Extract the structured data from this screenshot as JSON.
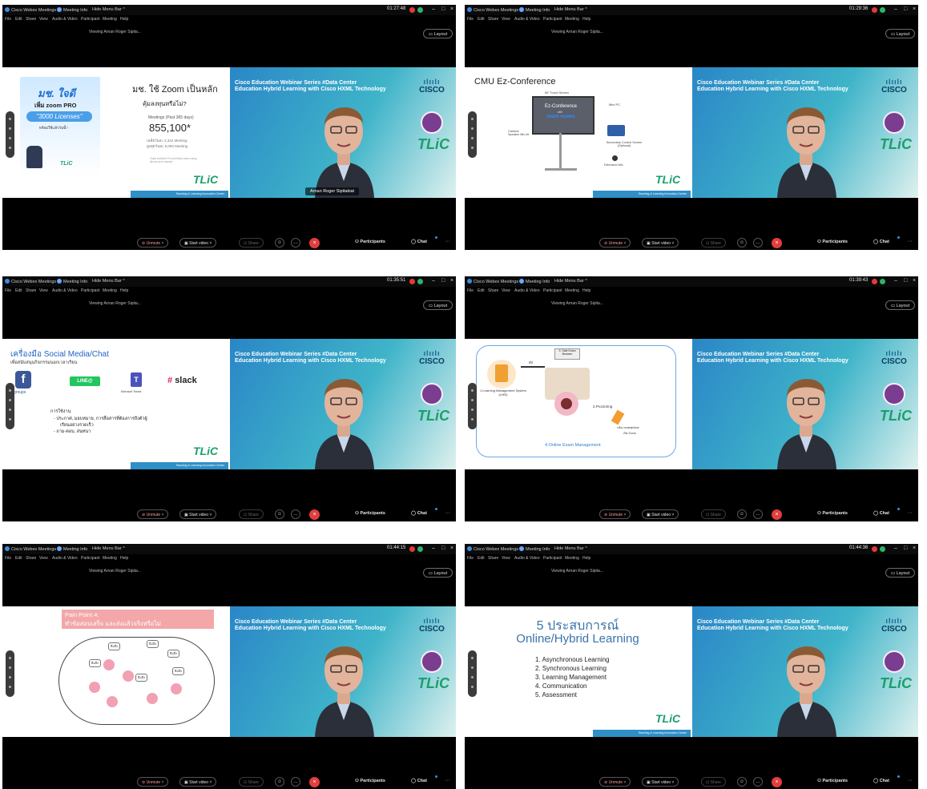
{
  "common": {
    "app_title": "Cisco Webex Meetings",
    "meeting_info": "Meeting Info",
    "hide_menu_bar": "Hide Menu Bar",
    "menu": [
      "File",
      "Edit",
      "Share",
      "View",
      "Audio & Video",
      "Participant",
      "Meeting",
      "Help"
    ],
    "viewing": "Viewing Arnan Roger Sipita...",
    "layout_label": "Layout",
    "unmute_label": "Unmute",
    "start_video_label": "Start video",
    "share_label": "Share",
    "participants_label": "Participants",
    "chat_label": "Chat",
    "video_title_line1": "Cisco Education Webinar Series #Data Center",
    "video_title_line2": "Education Hybrid Learning with Cisco HXML Technology",
    "cisco_brand": "CISCO",
    "tlic_brand": "TLiC",
    "slide_footer": "Teaching & Learning Innovation Center",
    "colors": {
      "end_button": "#e23e3e",
      "tlic_green": "#1aa06b",
      "recording_red": "#e03b3b"
    }
  },
  "screens": [
    {
      "time": "01:27:48",
      "name_tag": "Arnan Roger Sipitakiat",
      "slide": {
        "badge_line1": "มช. ใจดี",
        "badge_line2": "เพิ่ม zoom PRO",
        "badge_line3": "\"3000 Licenses\"",
        "badge_line4": "พร้อมใช้แล้ววันนี้ !",
        "title": "มช. ใช้ Zoom เป็นหลัก",
        "question": "คุ้มลงทุนหรือไม่?",
        "meetings_label": "Meetings (Past 365 days)",
        "meetings_value": "855,100*",
        "avg_line1": "เฉลี่ยวันละ 2,342 Meeting",
        "avg_line2": "สูงสุดวันละ 5,000 Meeting",
        "note": "*Data includes Pro and Basic users using @cmu.ac.th domain"
      }
    },
    {
      "time": "01:29:36",
      "slide": {
        "title": "CMU Ez-Conference",
        "label_touch": "65\" Touch Screen",
        "label_ez": "Ez-Conference",
        "label_with": "with",
        "label_zoom": "zoom rooms",
        "label_minipc": "Mini PC",
        "label_camera": "Camera Speaker Mic kit",
        "label_secondary": "Secondary Control Screen (Optional)",
        "label_extension": "Extension Mic"
      }
    },
    {
      "time": "01:35:51",
      "slide": {
        "title": "เครื่องมือ Social Media/Chat",
        "subtitle": "เพื่อสนับสนุนกิจกรรมนอกเวลาเรียน",
        "groups": "groups",
        "line": "LINE@",
        "teams": "Microsoft Teams",
        "slack": "slack",
        "usage": "การใช้งาน",
        "bullet1": "ประกาศ, มอบหมาย, การสื่อสารที่ต้องการถึงตัวผู้",
        "bullet1b": "เรียนอย่างรวดเร็ว",
        "bullet2": "ถาม-ตอบ, สนทนา"
      }
    },
    {
      "time": "01:39:43",
      "slide": {
        "step3": "3. Safe Exam Browser",
        "step1": "1.Learning Management System (LMS)",
        "step2": "2.Proctoring",
        "sent": "ส่ง",
        "phone_line1": "กล้อง smartphone",
        "phone_line2": "เปิด Zoom",
        "caption": "4.Online Exam Management"
      }
    },
    {
      "time": "01:44:15",
      "slide": {
        "title_line1": "Pain Point 4:",
        "title_line2": "ทำข้อสอบเสร็จ และส่งแล้วจริงหรือไม่",
        "bubbles": [
          "ยืมสิ่ง",
          "ยืมสิ่ง",
          "ยืมสิ่ง",
          "ยืมสิ่ง",
          "ยืมสิ่ง",
          "ยืมสิ่ง"
        ]
      }
    },
    {
      "time": "01:44:36",
      "slide": {
        "title_line1": "5 ประสบการณ์",
        "title_line2": "Online/Hybrid Learning",
        "items": [
          "1.  Asynchronous Learning",
          "2.  Synchronous Learning",
          "3.  Learning Management",
          "4.  Communication",
          "5.  Assessment"
        ]
      }
    }
  ]
}
